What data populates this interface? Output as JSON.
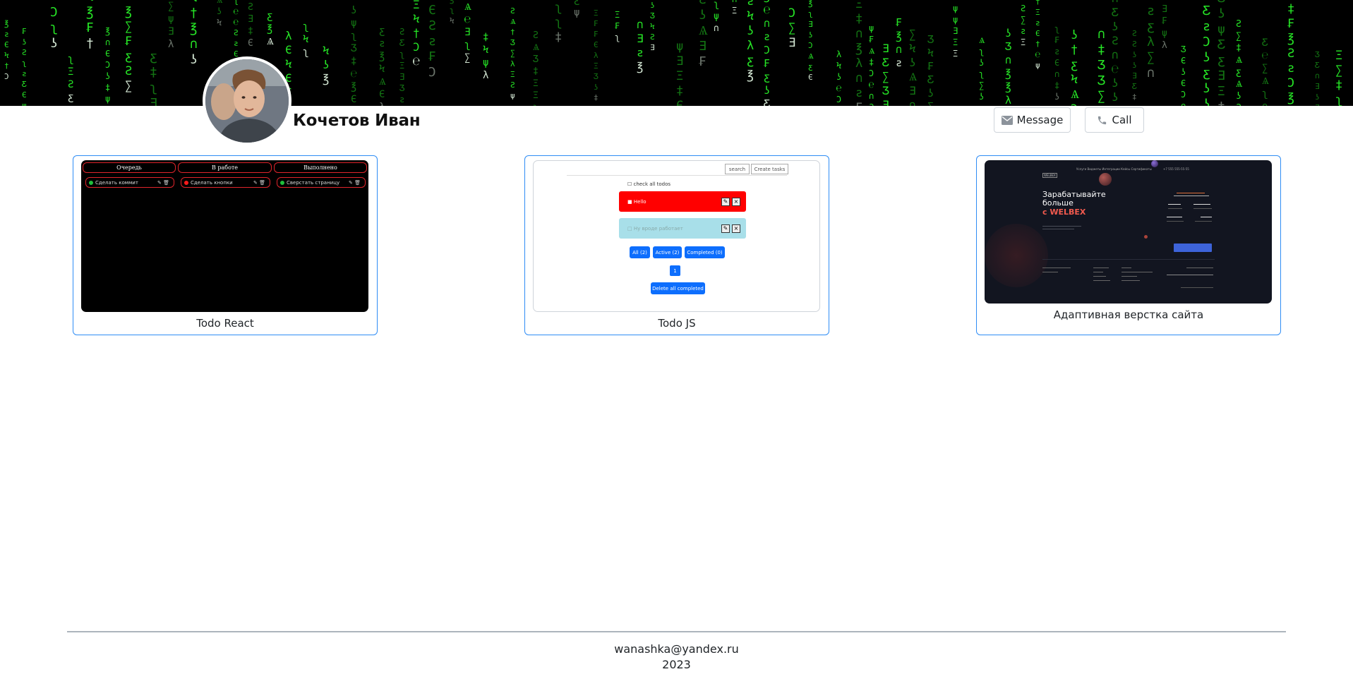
{
  "profile": {
    "name": "Кочетов Иван"
  },
  "actions": {
    "message_label": "Message",
    "call_label": "Call"
  },
  "projects": [
    {
      "caption": "Todo React",
      "preview": {
        "columns": [
          "Очередь",
          "В работе",
          "Выполнено"
        ],
        "tasks": [
          "Сделать коммит",
          "Сделать кнопки",
          "Сверстать страницу"
        ]
      }
    },
    {
      "caption": "Todo JS",
      "preview": {
        "search": "search",
        "create": "Create tasks",
        "check_all": "check all todos",
        "task_1": "Hello",
        "task_2": "Ну вроде работает",
        "filters": [
          "All (2)",
          "Active (2)",
          "Completed (0)"
        ],
        "page": "1",
        "delete_all": "Delete all completed"
      }
    },
    {
      "caption": "Адаптивная верстка сайта",
      "preview": {
        "logo": "WELBEX",
        "nav": "Услуги   Виджеты   Интеграции   Кейсы   Сертификаты",
        "phone": "+7 555 555-55-55",
        "title_line_1": "Зарабатывайте",
        "title_line_2": "больше",
        "title_brand": "с WELBEX"
      }
    }
  ],
  "footer": {
    "email": "wanashka@yandex.ru",
    "year": "2023"
  },
  "colors": {
    "card_border": "#2f8df5",
    "primary_button": "#0d6efd",
    "matrix_green": "#2bff2b",
    "todo_red": "#ff0000",
    "todo_cyan": "#a8dfe9"
  }
}
